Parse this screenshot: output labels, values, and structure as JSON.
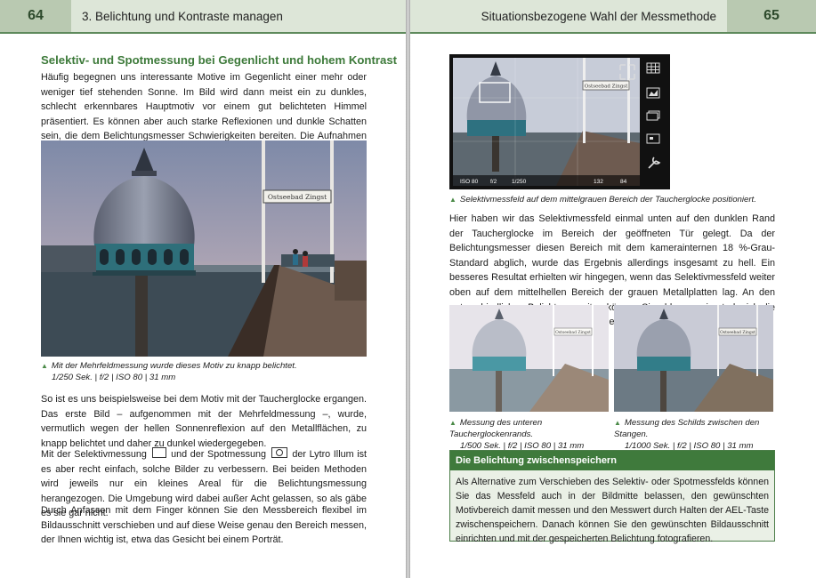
{
  "left_page": {
    "page_number": "64",
    "chapter": "3. Belichtung und Kontraste managen",
    "heading": "Selektiv- und Spotmessung bei Gegenlicht und hohem Kontrast",
    "para1": "Häufig begegnen uns interessante Motive im Gegenlicht einer mehr oder weniger tief stehenden Sonne. Im Bild wird dann meist ein zu dunkles, schlecht erkennbares Hauptmotiv vor einem gut belichteten Himmel präsentiert. Es können aber auch starke Reflexionen und dunkle Schatten sein, die dem Belichtungsmesser Schwierigkeiten bereiten. Die Aufnahmen sind dann insgesamt zu dunkel oder zu hell.",
    "photo_sign": "Ostseebad Zingst",
    "caption_line1": "Mit der Mehrfeldmessung wurde dieses Motiv zu knapp belichtet.",
    "caption_line2": "1/250 Sek. | f/2 | ISO 80 | 31 mm",
    "para2": "So ist es uns beispielsweise bei dem Motiv mit der Taucherglocke ergangen. Das erste Bild – aufgenommen mit der Mehrfeldmessung –, wurde, vermutlich wegen der hellen Sonnenreflexion auf den Metallflächen, zu knapp belichtet und daher zu dunkel wiedergegeben.",
    "para3_a": "Mit der Selektivmessung",
    "para3_b": "und der Spotmessung",
    "para3_c": "der Lytro Illum ist es aber recht einfach, solche Bilder zu verbessern. Bei beiden Methoden wird jeweils nur ein kleines Areal für die Belichtungsmessung herangezogen. Die Umgebung wird dabei außer Acht gelassen, so als gäbe es sie gar nicht.",
    "para4": "Durch Anfassen mit dem Finger können Sie den Messbereich flexibel im Bildausschnitt verschieben und auf diese Weise genau den Bereich messen, der Ihnen wichtig ist, etwa das Gesicht bei einem Porträt."
  },
  "right_page": {
    "page_number": "65",
    "chapter": "Situationsbezogene Wahl der Messmethode",
    "screen_sign": "Ostseebad Zingst",
    "screen_status": [
      "ISO 80",
      "f/2",
      "1/250",
      "132",
      "84"
    ],
    "caption_screen": "Selektivmessfeld auf dem mittelgrauen Bereich der Taucherglocke positioniert.",
    "para1": "Hier haben wir das Selektivmessfeld einmal unten auf den dunklen Rand der Taucherglocke im Bereich der geöffneten Tür gelegt. Da der Belichtungsmesser diesen Bereich mit dem kamerainternen 18 %-Grau-Standard abglich, wurde das Ergebnis allerdings insgesamt zu hell. Ein besseres Resultat erhielten wir hingegen, wenn das Selektivmessfeld weiter oben auf dem mittelhellen Bereich der grauen Metallplatten lag. An den unterschiedlichen Belichtungszeiten können Sie ablesen, wie stark sich die Belichtung der drei Bilder unterscheidet.",
    "photo_a_sign": "Ostseebad Zingst",
    "photo_b_sign": "Ostseebad Zingst",
    "caption_a_line1": "Messung des unteren Taucherglockenrands.",
    "caption_a_line2": "1/500 Sek. | f/2 | ISO 80 | 31 mm",
    "caption_b_line1": "Messung des Schilds zwischen den Stangen.",
    "caption_b_line2": "1/1000 Sek. | f/2 | ISO 80 | 31 mm",
    "box_title": "Die Belichtung zwischenspeichern",
    "box_text": "Als Alternative zum Verschieben des Selektiv- oder Spotmessfelds können Sie das Messfeld auch in der Bildmitte belassen, den gewünschten Motivbereich damit messen und den Messwert durch Halten der AEL-Taste zwischenspeichern. Danach können Sie den gewünschten Bildausschnitt einrichten und mit der gespeicherten Belichtung fotografieren."
  },
  "colors": {
    "accent_green": "#3d7a3a",
    "header_light": "#dde6d8",
    "header_dark": "#b9c9b1"
  },
  "icons": [
    "triangle-up-icon",
    "selective-metering-icon",
    "spot-metering-icon",
    "grid-icon",
    "histogram-icon",
    "layers-icon",
    "frame-icon",
    "wrench-icon",
    "expand-icon"
  ]
}
